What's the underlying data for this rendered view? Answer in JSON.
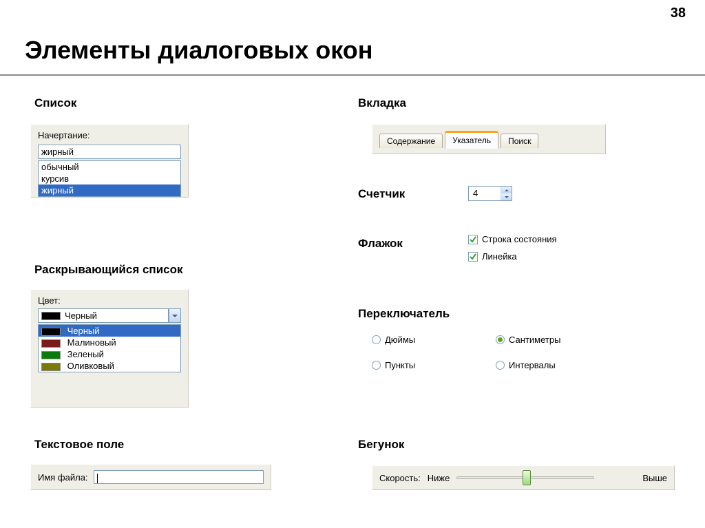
{
  "page_number": "38",
  "title": "Элементы диалоговых окон",
  "left": {
    "list": {
      "section": "Список",
      "label": "Начертание:",
      "value": "жирный",
      "items": [
        "обычный",
        "курсив",
        "жирный"
      ],
      "selected_index": 2
    },
    "dropdown": {
      "section": "Раскрывающийся список",
      "label": "Цвет:",
      "value": "Черный",
      "items": [
        {
          "label": "Черный",
          "color": "#000000"
        },
        {
          "label": "Малиновый",
          "color": "#7b1a1a"
        },
        {
          "label": "Зеленый",
          "color": "#0a7a0a"
        },
        {
          "label": "Оливковый",
          "color": "#7a7a0a"
        }
      ],
      "selected_index": 0
    },
    "textfield": {
      "section": "Текстовое поле",
      "label": "Имя файла:",
      "value": ""
    }
  },
  "right": {
    "tabs": {
      "section": "Вкладка",
      "items": [
        "Содержание",
        "Указатель",
        "Поиск"
      ],
      "active_index": 1
    },
    "counter": {
      "section": "Счетчик",
      "value": "4"
    },
    "checkbox": {
      "section": "Флажок",
      "items": [
        {
          "label": "Строка состояния",
          "checked": true
        },
        {
          "label": "Линейка",
          "checked": true
        }
      ]
    },
    "radio": {
      "section": "Переключатель",
      "items": [
        {
          "label": "Дюймы",
          "selected": false
        },
        {
          "label": "Сантиметры",
          "selected": true
        },
        {
          "label": "Пункты",
          "selected": false
        },
        {
          "label": "Интервалы",
          "selected": false
        }
      ]
    },
    "slider": {
      "section": "Бегунок",
      "label": "Скорость:",
      "min_label": "Ниже",
      "max_label": "Выше"
    }
  }
}
